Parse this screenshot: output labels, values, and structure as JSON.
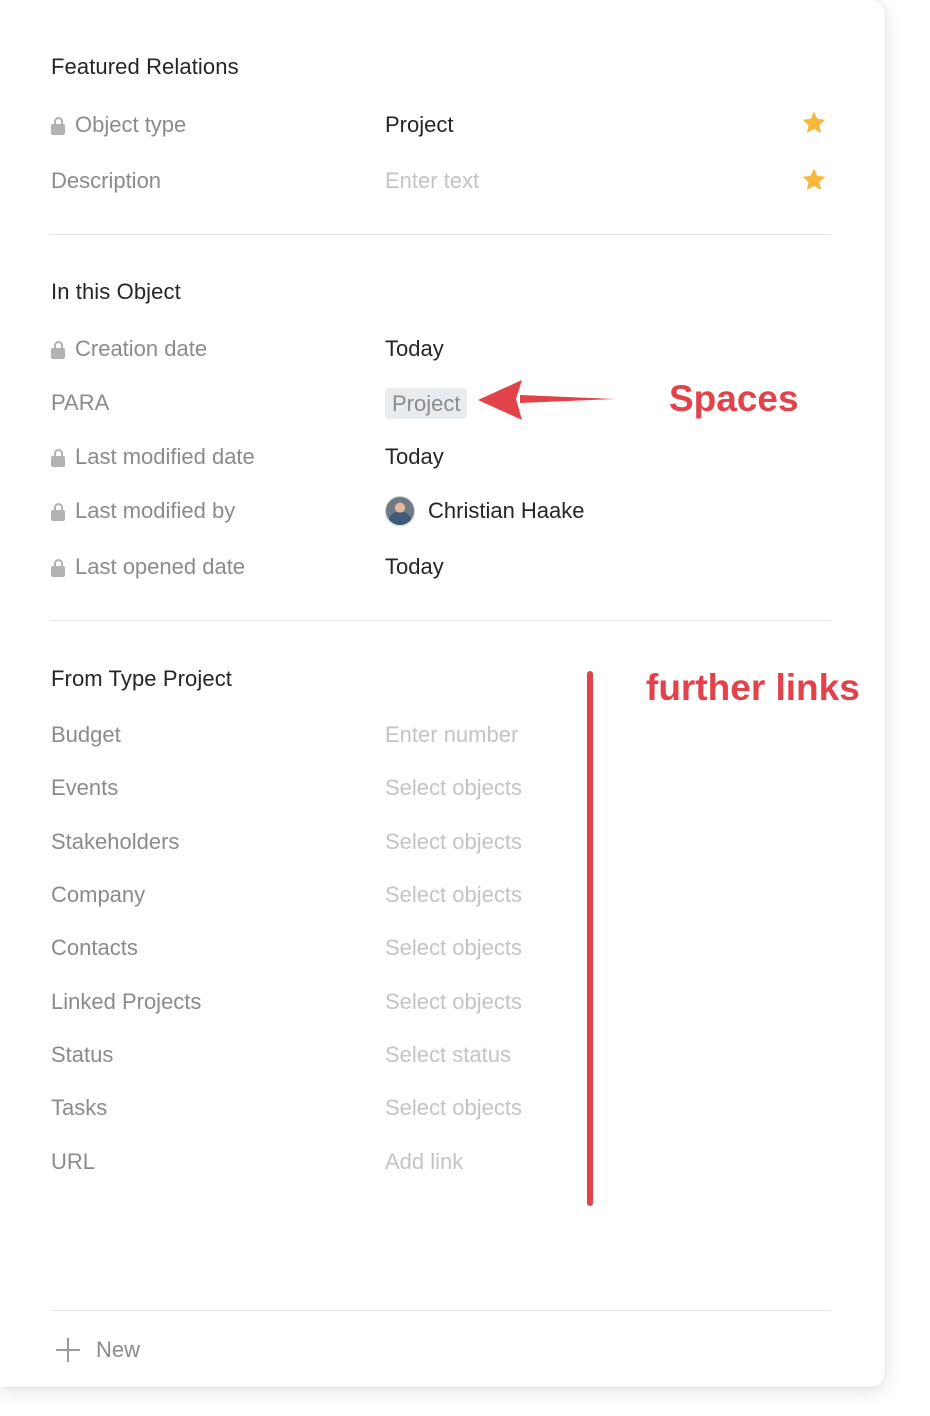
{
  "featured": {
    "title": "Featured Relations",
    "rows": [
      {
        "name": "Object type",
        "value": "Project"
      },
      {
        "name": "Description",
        "value": "Enter text"
      }
    ]
  },
  "in_object": {
    "title": "In this Object",
    "rows": [
      {
        "name": "Creation date",
        "value": "Today"
      },
      {
        "name": "PARA",
        "value": "Project"
      },
      {
        "name": "Last modified date",
        "value": "Today"
      },
      {
        "name": "Last modified by",
        "value": "Christian Haake"
      },
      {
        "name": "Last opened date",
        "value": "Today"
      }
    ]
  },
  "from_type": {
    "title": "From Type Project",
    "rows": [
      {
        "name": "Budget",
        "value": "Enter number"
      },
      {
        "name": "Events",
        "value": "Select objects"
      },
      {
        "name": "Stakeholders",
        "value": "Select objects"
      },
      {
        "name": "Company",
        "value": "Select objects"
      },
      {
        "name": "Contacts",
        "value": "Select objects"
      },
      {
        "name": "Linked Projects",
        "value": "Select objects"
      },
      {
        "name": "Status",
        "value": "Select status"
      },
      {
        "name": "Tasks",
        "value": "Select objects"
      },
      {
        "name": "URL",
        "value": "Add link"
      }
    ]
  },
  "footer": {
    "new_label": "New"
  },
  "annotations": {
    "spaces": "Spaces",
    "further_links": "further links"
  },
  "icons": {
    "lock": "lock-icon",
    "star": "star-icon",
    "plus": "plus-icon",
    "arrow": "arrow-annotation"
  },
  "colors": {
    "star": "#f6b73c",
    "annotation": "#e2434b",
    "tag_bg": "#e9ecef"
  }
}
